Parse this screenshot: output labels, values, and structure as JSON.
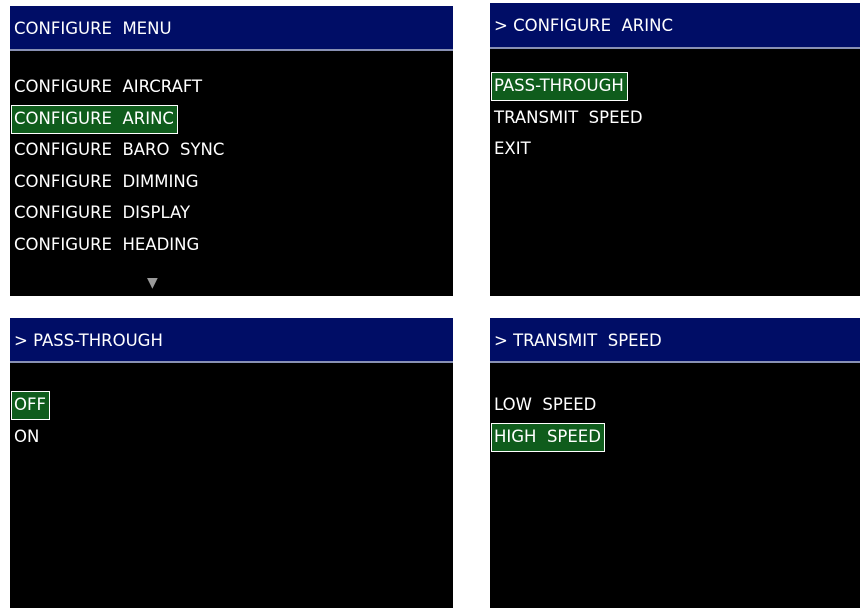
{
  "screens": {
    "configure_menu": {
      "title": "CONFIGURE  MENU",
      "items": [
        {
          "label": "CONFIGURE  AIRCRAFT"
        },
        {
          "label": "CONFIGURE  ARINC"
        },
        {
          "label": "CONFIGURE  BARO  SYNC"
        },
        {
          "label": "CONFIGURE  DIMMING"
        },
        {
          "label": "CONFIGURE  DISPLAY"
        },
        {
          "label": "CONFIGURE  HEADING"
        }
      ],
      "selected_index": 1,
      "scroll_indicator": "▼"
    },
    "configure_arinc": {
      "title": "> CONFIGURE  ARINC",
      "items": [
        {
          "label": "PASS-THROUGH"
        },
        {
          "label": "TRANSMIT  SPEED"
        },
        {
          "label": "EXIT"
        }
      ],
      "selected_index": 0
    },
    "pass_through": {
      "title": "> PASS-THROUGH",
      "items": [
        {
          "label": "OFF"
        },
        {
          "label": "ON"
        }
      ],
      "selected_index": 0
    },
    "transmit_speed": {
      "title": "> TRANSMIT  SPEED",
      "items": [
        {
          "label": "LOW  SPEED"
        },
        {
          "label": "HIGH  SPEED"
        }
      ],
      "selected_index": 1
    }
  },
  "colors": {
    "title_bar": "#000d66",
    "title_rule": "#8890b4",
    "screen_bg": "#000000",
    "text": "#ffffff",
    "selection_fill": "#0f5c1c",
    "selection_border": "#ffffff",
    "scroll_arrow": "#9a9a9a"
  }
}
